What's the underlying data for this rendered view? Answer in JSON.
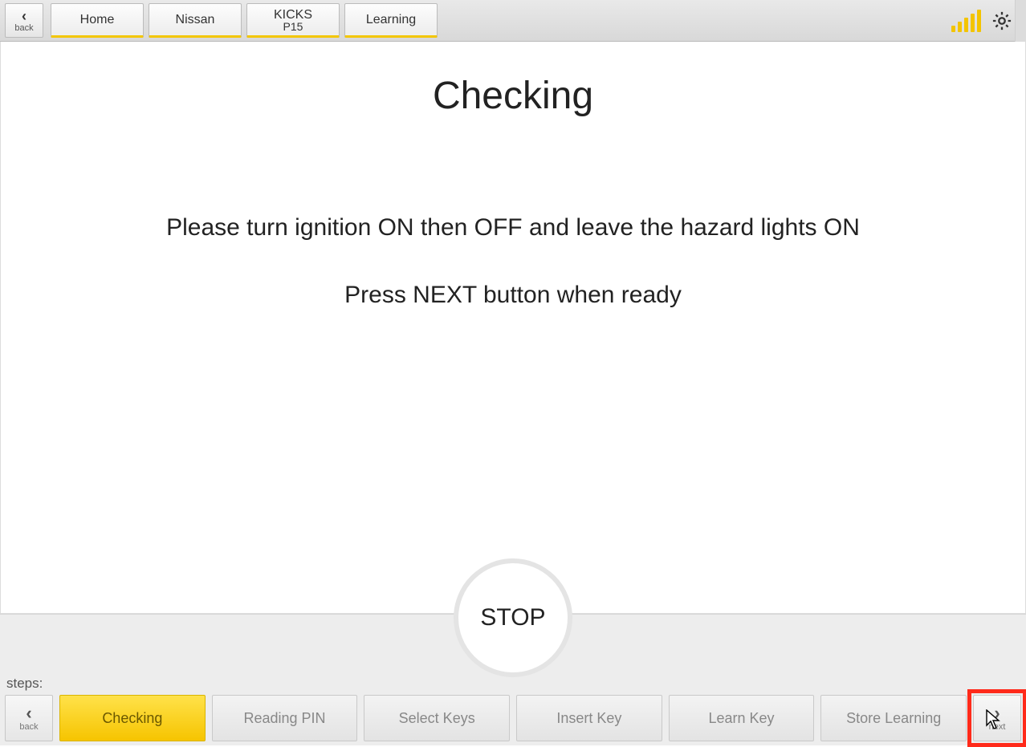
{
  "topbar": {
    "back_label": "back",
    "crumbs": [
      {
        "line1": "Home",
        "line2": ""
      },
      {
        "line1": "Nissan",
        "line2": ""
      },
      {
        "line1": "KICKS",
        "line2": "P15"
      },
      {
        "line1": "Learning",
        "line2": ""
      }
    ]
  },
  "main": {
    "title": "Checking",
    "instruction1": "Please turn ignition ON then OFF and leave the hazard lights ON",
    "instruction2": "Press NEXT button when ready",
    "stop_label": "STOP"
  },
  "steps": {
    "label": "steps:",
    "back_label": "back",
    "next_label": "next",
    "items": [
      {
        "label": "Checking",
        "active": true
      },
      {
        "label": "Reading PIN",
        "active": false
      },
      {
        "label": "Select Keys",
        "active": false
      },
      {
        "label": "Insert Key",
        "active": false
      },
      {
        "label": "Learn Key",
        "active": false
      },
      {
        "label": "Store Learning",
        "active": false
      }
    ]
  },
  "colors": {
    "accent": "#f3c600",
    "highlight": "#ff2a1a"
  }
}
